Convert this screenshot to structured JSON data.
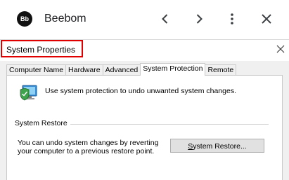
{
  "app": {
    "avatar_text": "Bb",
    "title": "Beebom",
    "icons": [
      "back-icon",
      "forward-icon",
      "more-vert-icon",
      "close-icon"
    ]
  },
  "dialog": {
    "title": "System Properties",
    "highlight_color": "#e00000",
    "tabs": [
      {
        "label": "Computer Name",
        "active": false
      },
      {
        "label": "Hardware",
        "active": false
      },
      {
        "label": "Advanced",
        "active": false
      },
      {
        "label": "System Protection",
        "active": true
      },
      {
        "label": "Remote",
        "active": false
      }
    ],
    "intro_text": "Use system protection to undo unwanted system changes.",
    "system_restore": {
      "group_label": "System Restore",
      "description_line1": "You can undo system changes by reverting",
      "description_line2": "your computer to a previous restore point.",
      "button_label_first": "S",
      "button_label_rest": "ystem Restore..."
    }
  }
}
